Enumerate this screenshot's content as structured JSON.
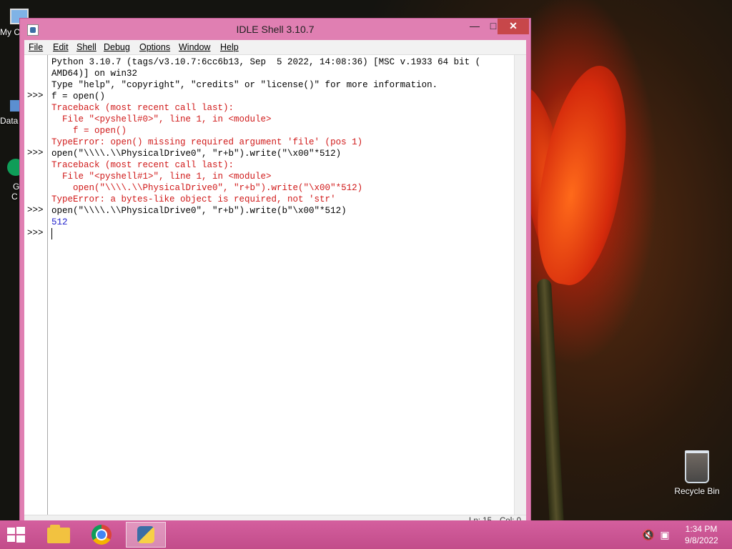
{
  "window": {
    "title": "IDLE Shell 3.10.7",
    "menu": [
      "File",
      "Edit",
      "Shell",
      "Debug",
      "Options",
      "Window",
      "Help"
    ]
  },
  "shell": {
    "prompt": ">>>",
    "lines": [
      {
        "text": "Python 3.10.7 (tags/v3.10.7:6cc6b13, Sep  5 2022, 14:08:36) [MSC v.1933 64 bit (",
        "color": "black"
      },
      {
        "text": "AMD64)] on win32",
        "color": "black"
      },
      {
        "text": "Type \"help\", \"copyright\", \"credits\" or \"license()\" for more information.",
        "color": "black"
      },
      {
        "text": "f = open()",
        "color": "black"
      },
      {
        "text": "Traceback (most recent call last):",
        "color": "red"
      },
      {
        "text": "  File \"<pyshell#0>\", line 1, in <module>",
        "color": "red"
      },
      {
        "text": "    f = open()",
        "color": "red"
      },
      {
        "text": "TypeError: open() missing required argument 'file' (pos 1)",
        "color": "red"
      },
      {
        "text": "open(\"\\\\\\\\.\\\\PhysicalDrive0\", \"r+b\").write(\"\\x00\"*512)",
        "color": "black"
      },
      {
        "text": "Traceback (most recent call last):",
        "color": "red"
      },
      {
        "text": "  File \"<pyshell#1>\", line 1, in <module>",
        "color": "red"
      },
      {
        "text": "    open(\"\\\\\\\\.\\\\PhysicalDrive0\", \"r+b\").write(\"\\x00\"*512)",
        "color": "red"
      },
      {
        "text": "TypeError: a bytes-like object is required, not 'str'",
        "color": "red"
      },
      {
        "text": "open(\"\\\\\\\\.\\\\PhysicalDrive0\", \"r+b\").write(b\"\\x00\"*512)",
        "color": "black"
      },
      {
        "text": "512",
        "color": "blue"
      }
    ],
    "prompt_rows": [
      3,
      8,
      13,
      15
    ]
  },
  "status": {
    "ln": "Ln: 15",
    "col": "Col: 0"
  },
  "desktop": {
    "icons": [
      "My C",
      "Data",
      "G",
      "C"
    ],
    "recycle_bin": "Recycle Bin"
  },
  "taskbar": {
    "time": "1:34 PM",
    "date": "9/8/2022"
  },
  "colors": {
    "window_frame": "#e07fb2",
    "close_button": "#c7474a",
    "error_text": "#d01919",
    "output_blue": "#2020cc",
    "string_green": "#1a8d1a",
    "taskbar": "#c24c8a"
  }
}
